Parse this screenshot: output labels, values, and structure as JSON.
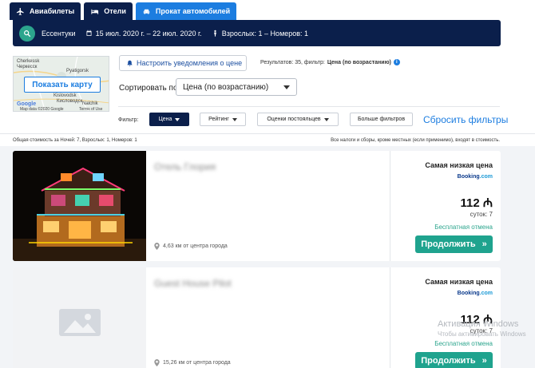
{
  "tabs": [
    {
      "label": "Авиабилеты",
      "icon": "plane-icon"
    },
    {
      "label": "Отели",
      "icon": "bed-icon"
    },
    {
      "label": "Прокат автомобилей",
      "icon": "car-icon"
    }
  ],
  "search": {
    "destination": "Ессентуки",
    "dates": "15 июл. 2020 г. – 22 июл. 2020 г.",
    "guests": "Взрослых: 1 – Номеров: 1"
  },
  "map": {
    "button_label": "Показать карту",
    "labels": {
      "cherkessk_en": "Cherkessk",
      "cherkessk_ru": "Черкесск",
      "pyatigorsk": "Pyatigorsk",
      "kislovodsk_en": "Kislovodsk",
      "kislovodsk_ru": "Кисловодск",
      "nalchik": "Nalchik"
    },
    "google_logo": "Google",
    "copyright": "Map data ©2020 Google",
    "terms": "Terms of Use"
  },
  "alerts": {
    "label": "Настроить уведомления о цене"
  },
  "results": {
    "prefix": "Результатов: 35, фильтр:",
    "filter": "Цена (по возрастанию)"
  },
  "sort": {
    "label": "Сортировать по",
    "value": "Цена (по возрастанию)"
  },
  "filters": {
    "label": "Фильтр:",
    "buttons": [
      "Цена",
      "Рейтинг",
      "Оценки постояльцев",
      "Больше фильтров"
    ],
    "reset": "Сбросить фильтры"
  },
  "summary": "Общая стоимость за Ночей: 7, Взрослых: 1, Номеров: 1",
  "tax_note": "Все налоги и сборы, кроме местных (если применимо), входят в стоимость.",
  "hotels": [
    {
      "name": "Отель Глория",
      "distance": "4,63 км от центра города",
      "price_label": "Самая низкая цена",
      "provider": "Booking",
      "provider_suffix": ".com",
      "price": "112 ₼",
      "nights": "суток: 7",
      "cancel": "Бесплатная отмена",
      "cta": "Продолжить"
    },
    {
      "name": "Guest House Pilot",
      "distance": "15,26 км от центра города",
      "price_label": "Самая низкая цена",
      "provider": "Booking",
      "provider_suffix": ".com",
      "price": "112 ₼",
      "nights": "суток: 7",
      "cancel": "Бесплатная отмена",
      "cta": "Продолжить"
    }
  ],
  "watermark": {
    "line1": "Активация Windows",
    "line2": "Чтобы активировать Windows"
  },
  "colors": {
    "navy": "#0b1f4b",
    "blue": "#1c7de0",
    "teal": "#1fa38e"
  }
}
